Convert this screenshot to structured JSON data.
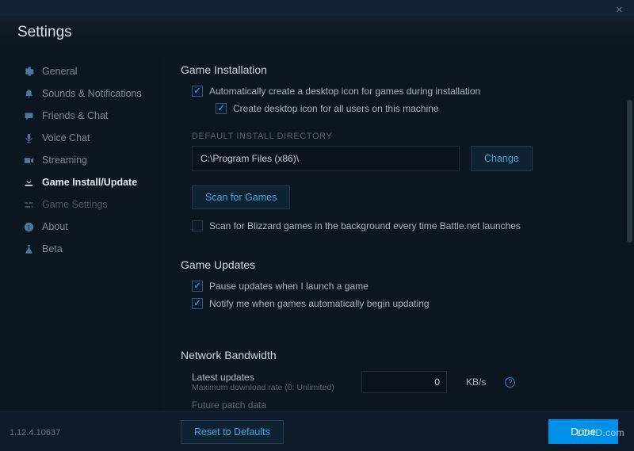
{
  "window": {
    "title": "Settings"
  },
  "sidebar": {
    "items": [
      {
        "label": "General",
        "icon": "gear"
      },
      {
        "label": "Sounds & Notifications",
        "icon": "bell"
      },
      {
        "label": "Friends & Chat",
        "icon": "chat"
      },
      {
        "label": "Voice Chat",
        "icon": "mic"
      },
      {
        "label": "Streaming",
        "icon": "camera"
      },
      {
        "label": "Game Install/Update",
        "icon": "download",
        "active": true
      },
      {
        "label": "Game Settings",
        "icon": "sliders",
        "dim": true
      },
      {
        "label": "About",
        "icon": "info"
      },
      {
        "label": "Beta",
        "icon": "flask"
      }
    ]
  },
  "install": {
    "title": "Game Installation",
    "auto_icon_label": "Automatically create a desktop icon for games during installation",
    "auto_icon_checked": true,
    "all_users_label": "Create desktop icon for all users on this machine",
    "all_users_checked": true,
    "dir_subhead": "DEFAULT INSTALL DIRECTORY",
    "dir_value": "C:\\Program Files (x86)\\",
    "change_label": "Change",
    "scan_label": "Scan for Games",
    "bg_scan_label": "Scan for Blizzard games in the background every time Battle.net launches",
    "bg_scan_checked": false
  },
  "updates": {
    "title": "Game Updates",
    "pause_label": "Pause updates when I launch a game",
    "pause_checked": true,
    "notify_label": "Notify me when games automatically begin updating",
    "notify_checked": true
  },
  "bandwidth": {
    "title": "Network Bandwidth",
    "latest_label": "Latest updates",
    "latest_help": "Maximum download rate (0: Unlimited)",
    "latest_value": "0",
    "unit": "KB/s",
    "future_label": "Future patch data"
  },
  "footer": {
    "reset_label": "Reset to Defaults",
    "done_label": "Done",
    "version": "1.12.4.10637",
    "watermark": "LO4D.com"
  }
}
